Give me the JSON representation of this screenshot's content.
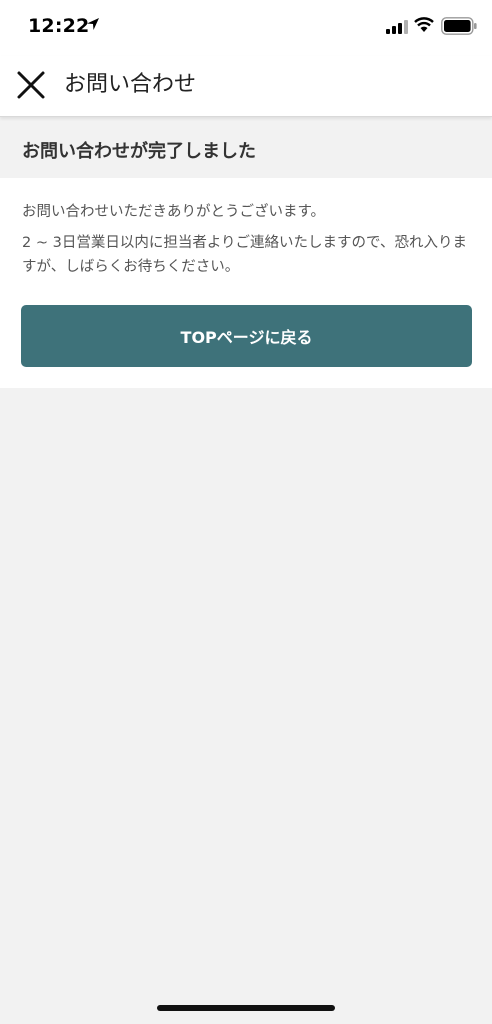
{
  "status_bar": {
    "time": "12:22",
    "icons": [
      "location-arrow-icon",
      "signal-icon",
      "wifi-icon",
      "battery-icon"
    ]
  },
  "nav": {
    "title": "お問い合わせ",
    "close_icon": "close-icon"
  },
  "complete": {
    "title": "お問い合わせが完了しました"
  },
  "message": {
    "line1": "お問い合わせいただきありがとうございます。",
    "line2": "2 ~ 3日営業日以内に担当者よりご連絡いたしますので、恐れ入りますが、しばらくお待ちください。"
  },
  "actions": {
    "top_button": "TOPページに戻る"
  },
  "colors": {
    "accent": "#3e727a",
    "background": "#f2f2f2",
    "card": "#ffffff"
  }
}
